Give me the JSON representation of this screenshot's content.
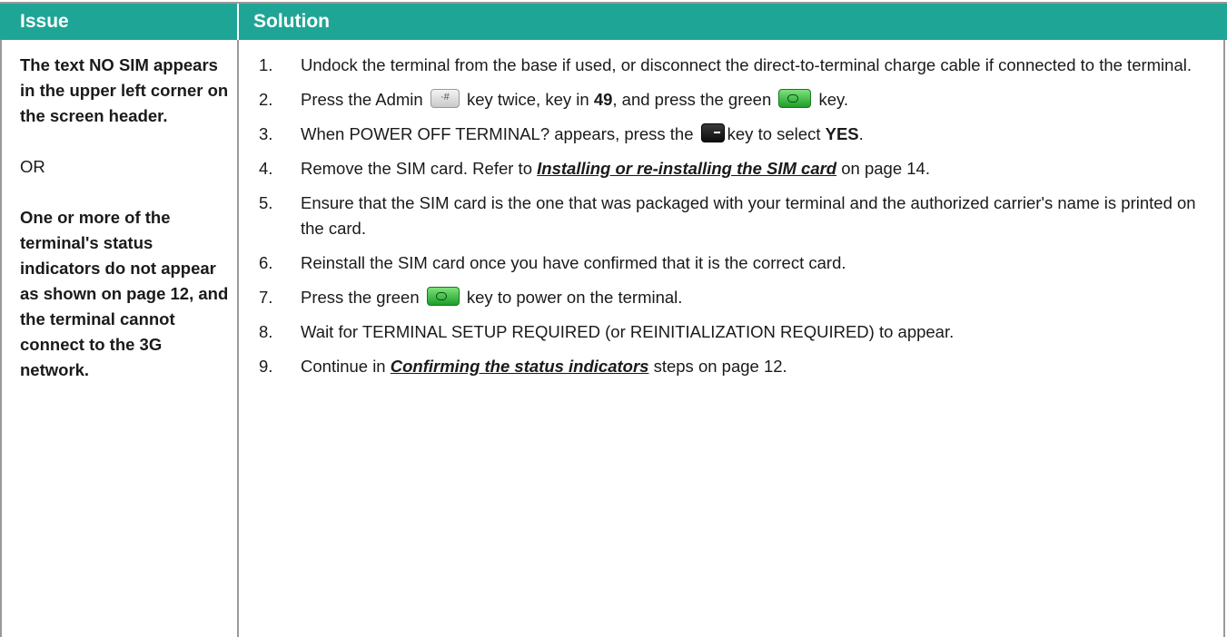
{
  "header": {
    "issue": "Issue",
    "solution": "Solution"
  },
  "issue": {
    "p1": "The text NO SIM appears in the upper left corner on the screen header.",
    "or": "OR",
    "p2": "One or more of the terminal's status indicators do not appear as shown on page 12, and the terminal cannot connect to the 3G network."
  },
  "steps": [
    {
      "num": "1.",
      "text": "Undock the terminal from the base if used, or disconnect the direct-to-terminal charge cable if connected to the terminal."
    },
    {
      "num": "2.",
      "a": "Press the Admin",
      "b": "key twice, key in",
      "bold": "49",
      "c": ", and press the green",
      "d": "key."
    },
    {
      "num": "3.",
      "a": "When POWER OFF TERMINAL? appears, press the",
      "b": "key to select",
      "bold": "YES",
      "c": "."
    },
    {
      "num": "4.",
      "a": "Remove the SIM card. Refer to",
      "link": "Installing or re-installing the SIM card",
      "b": "on page 14."
    },
    {
      "num": "5.",
      "text": "Ensure that the SIM card is the one that was packaged with your terminal and the authorized carrier's name is printed on the card."
    },
    {
      "num": "6.",
      "text": "Reinstall the SIM card once you have confirmed that it is the correct card."
    },
    {
      "num": "7.",
      "a": "Press the green",
      "b": "key to power on the terminal."
    },
    {
      "num": "8.",
      "text": "Wait for TERMINAL SETUP REQUIRED (or REINITIALIZATION REQUIRED) to appear."
    },
    {
      "num": "9.",
      "a": "Continue in",
      "link": "Confirming the status indicators",
      "b": "steps on page 12."
    }
  ],
  "icons": {
    "admin_key": "admin-key-icon",
    "green_key": "green-key-icon",
    "yes_key": "black-softkey-icon"
  },
  "colors": {
    "header_bg": "#1fa595",
    "header_text": "#ffffff",
    "border": "#9a9a9a"
  },
  "key_glyphs": {
    "admin": "·#"
  }
}
